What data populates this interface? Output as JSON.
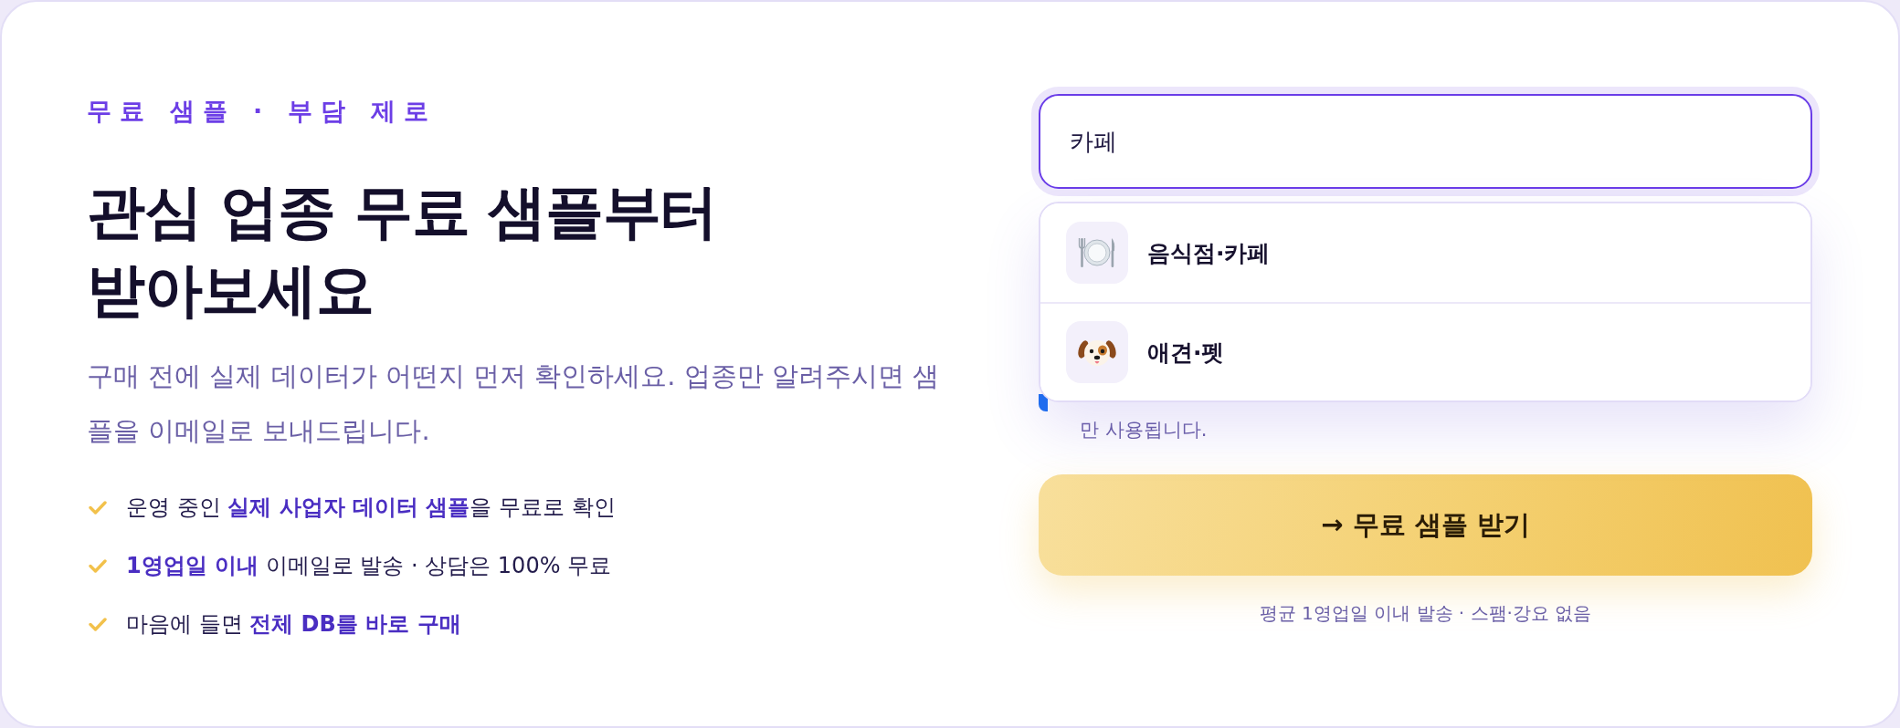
{
  "hero": {
    "eyebrow": "무료 샘플 · 부담 제로",
    "title": "관심 업종 무료 샘플부터\n받아보세요",
    "description": "구매 전에 실제 데이터가 어떤지 먼저 확인하세요. 업종만 알려주시면 샘플을 이메일로 보내드립니다.",
    "benefits": [
      "운영 중인 **실제 사업자 데이터 샘플**을 무료로 확인",
      "**1영업일 이내** 이메일로 발송 · 상담은 100% 무료",
      "마음에 들면 **전체 DB를 바로 구매**"
    ]
  },
  "form": {
    "industry_field": {
      "value": "카페",
      "focused": true
    },
    "suggestions": [
      {
        "label": "음식점·카페",
        "kind": "food",
        "selected": false
      },
      {
        "label": "애견·펫",
        "kind": "pet",
        "selected": false
      }
    ],
    "consent_note": "만 사용됩니다.",
    "submit_button": "→ 무료 샘플 받기",
    "footnote": "평균 1영업일 이내 발송 · 스팸·강요 없음"
  }
}
